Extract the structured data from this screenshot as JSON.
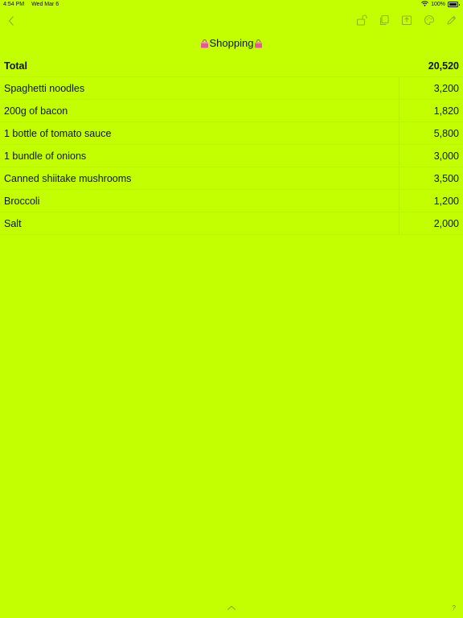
{
  "status": {
    "time": "4:54 PM",
    "date": "Wed Mar 6",
    "battery": "100%"
  },
  "toolbar": {
    "icons": [
      "chevron-left-icon",
      "unlock-icon",
      "copy-icon",
      "share-icon",
      "palette-icon",
      "pencil-icon"
    ]
  },
  "title": "Shopping",
  "total": {
    "label": "Total",
    "amount": "20,520"
  },
  "items": [
    {
      "name": "Spaghetti noodles",
      "amount": "3,200"
    },
    {
      "name": "200g of bacon",
      "amount": "1,820"
    },
    {
      "name": "1 bottle of tomato sauce",
      "amount": "5,800"
    },
    {
      "name": "1 bundle of onions",
      "amount": "3,000"
    },
    {
      "name": "Canned shiitake mushrooms",
      "amount": "3,500"
    },
    {
      "name": "Broccoli",
      "amount": "1,200"
    },
    {
      "name": "Salt",
      "amount": "2,000"
    }
  ],
  "help_label": "?",
  "colors": {
    "background": "#c3ff00",
    "icon": "#8fb51a",
    "bag": "#e35a9b"
  }
}
